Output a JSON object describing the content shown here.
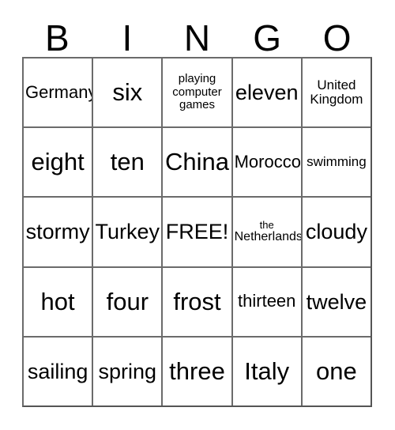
{
  "card": {
    "title_letters": [
      "B",
      "I",
      "N",
      "G",
      "O"
    ],
    "free_space_label": "FREE!",
    "colors": {
      "background": "#ffffff",
      "grid_line": "#6b6b6b",
      "text": "#000000"
    },
    "grid": {
      "columns": 5,
      "rows": 5,
      "cells": [
        [
          {
            "text": "Germany",
            "size": "fs-md"
          },
          {
            "text": "six",
            "size": "fs-xl"
          },
          {
            "text": "playing\ncomputer\ngames",
            "size": "fs-xs"
          },
          {
            "text": "eleven",
            "size": "fs-lg"
          },
          {
            "text": "United\nKingdom",
            "size": "fs-sm"
          }
        ],
        [
          {
            "text": "eight",
            "size": "fs-xl"
          },
          {
            "text": "ten",
            "size": "fs-xl"
          },
          {
            "text": "China",
            "size": "fs-xl"
          },
          {
            "text": "Morocco",
            "size": "fs-md"
          },
          {
            "text": "swimming",
            "size": "fs-sm"
          }
        ],
        [
          {
            "text": "stormy",
            "size": "fs-lg"
          },
          {
            "text": "Turkey",
            "size": "fs-lg"
          },
          {
            "text": "FREE!",
            "size": "fs-lg"
          },
          {
            "text": "the\nNetherlands",
            "size": "fs-xxs"
          },
          {
            "text": "cloudy",
            "size": "fs-lg"
          }
        ],
        [
          {
            "text": "hot",
            "size": "fs-xl"
          },
          {
            "text": "four",
            "size": "fs-xl"
          },
          {
            "text": "frost",
            "size": "fs-xl"
          },
          {
            "text": "thirteen",
            "size": "fs-md"
          },
          {
            "text": "twelve",
            "size": "fs-lg"
          }
        ],
        [
          {
            "text": "sailing",
            "size": "fs-lg"
          },
          {
            "text": "spring",
            "size": "fs-lg"
          },
          {
            "text": "three",
            "size": "fs-xl"
          },
          {
            "text": "Italy",
            "size": "fs-xl"
          },
          {
            "text": "one",
            "size": "fs-xl"
          }
        ]
      ]
    }
  }
}
